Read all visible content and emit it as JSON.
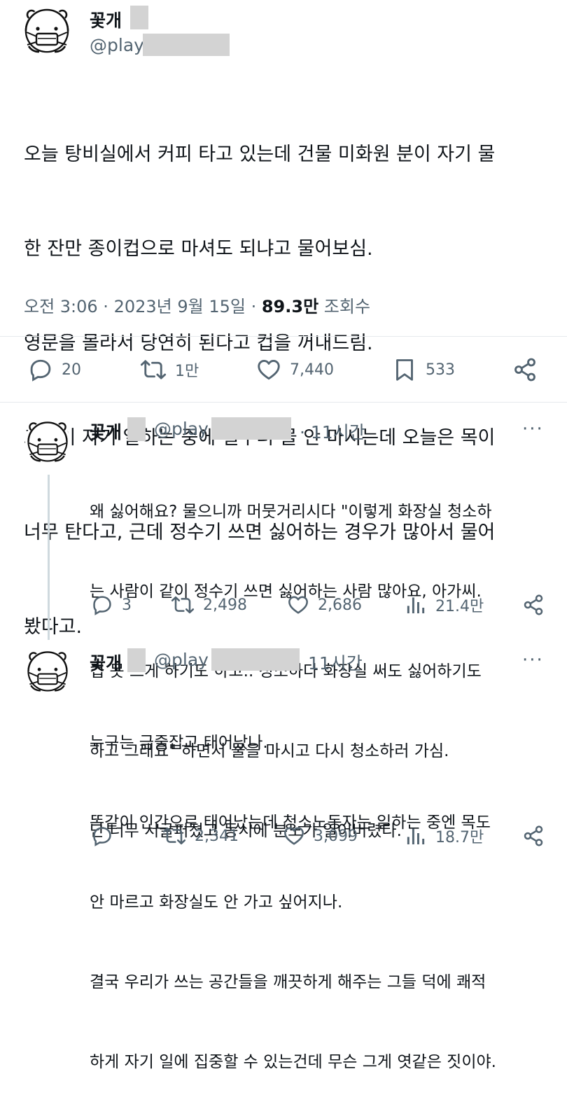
{
  "main_tweet": {
    "display_name": "꽃개",
    "handle": "@play",
    "lines": [
      "오늘 탕비실에서 커피 타고 있는데 건물 미화원 분이 자기 물",
      "한 잔만 종이컵으로 마셔도 되냐고 물어보심.",
      "영문을 몰라서 당연히 된다고 컵을 꺼내드림.",
      "그분이 자기 일하는 중에 일부러 물 안 마시는데 오늘은 목이",
      "너무 탄다고, 근데 정수기 쓰면 싫어하는 경우가 많아서 물어",
      "봤다고."
    ],
    "time": "오전 3:06 · 2023년 9월 15일 ·",
    "views_count": "89.3만",
    "views_label": "조회수",
    "replies": "20",
    "retweets": "1만",
    "likes": "7,440",
    "bookmarks": "533"
  },
  "reply1": {
    "display_name": "꽃개",
    "handle": "@play",
    "time": "· 11시간",
    "lines": [
      "왜 싫어해요? 물으니까 머뭇거리시다 \"이렇게 화장실 청소하",
      "는 사람이 같이 정수기 쓰면 싫어하는 사람 많아요, 아가씨.",
      "컵 못 쓰게 하기도 하고.. 청소하다 화장실 써도 싫어하기도",
      "하고 그래요\" 하면서 물을 마시고 다시 청소하러 가심.",
      "난 너무 서글퍼졌고 동시에 분노가 일어버렸다."
    ],
    "replies": "3",
    "retweets": "2,498",
    "likes": "2,686",
    "views": "21.4만"
  },
  "reply2": {
    "display_name": "꽃개",
    "handle": "@play",
    "time": "11시간",
    "lines": [
      "누구는 금줄잡고 태어났나.",
      "똑같이 인간으로 태어났는데 청소노동자는 일하는 중엔 목도",
      "안 마르고 화장실도 안 가고 싶어지나.",
      "결국 우리가 쓰는 공간들을 깨끗하게 해주는 그들 덕에 쾌적",
      "하게 자기 일에 집중할 수 있는건데 무슨 그게 엿같은 짓이야."
    ],
    "replies": "",
    "retweets": "2,341",
    "likes": "3,099",
    "views": "18.7만"
  },
  "more_label": "···",
  "icons": [
    "avatar-bear-mask-icon",
    "reply-icon",
    "retweet-icon",
    "like-icon",
    "bookmark-icon",
    "share-icon",
    "views-icon",
    "more-icon"
  ]
}
